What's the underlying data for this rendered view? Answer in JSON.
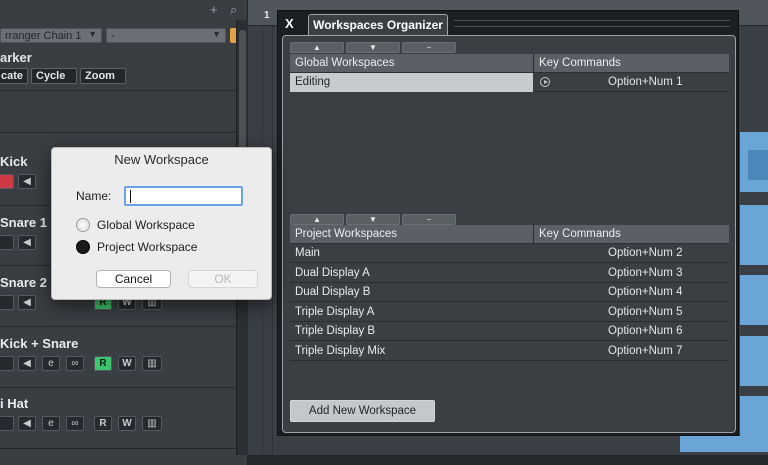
{
  "left_panel": {
    "arranger_dropdown": "rranger Chain 1",
    "arranger_dropdown2": "-",
    "marker_label": "arker",
    "marker_buttons": [
      "cate",
      "Cycle",
      "Zoom"
    ],
    "tracks": [
      {
        "name": "Kick"
      },
      {
        "name": "Snare 1"
      },
      {
        "name": "Snare 2"
      },
      {
        "name": "Kick + Snare"
      },
      {
        "name": "i Hat"
      }
    ],
    "track_button_glyphs": {
      "mute": "◀",
      "edit": "e",
      "link": "∞",
      "read": "R",
      "write": "W",
      "lanes": "▥"
    }
  },
  "ruler": {
    "bar_number": "1"
  },
  "new_workspace_dialog": {
    "title": "New Workspace",
    "name_label": "Name:",
    "name_value": "",
    "options": [
      {
        "label": "Global Workspace",
        "selected": false
      },
      {
        "label": "Project Workspace",
        "selected": true
      }
    ],
    "cancel_label": "Cancel",
    "ok_label": "OK",
    "ok_enabled": false
  },
  "organizer": {
    "close_label": "X",
    "tab_title": "Workspaces Organizer",
    "toolbar_glyphs": [
      "▲",
      "▼",
      "−"
    ],
    "global": {
      "header_name": "Global Workspaces",
      "header_keys": "Key Commands",
      "rows": [
        {
          "name": "Editing",
          "keys": "Option+Num 1",
          "selected": true,
          "has_icon": true
        }
      ]
    },
    "project": {
      "header_name": "Project Workspaces",
      "header_keys": "Key Commands",
      "rows": [
        {
          "name": "Main",
          "keys": "Option+Num 2"
        },
        {
          "name": "Dual Display A",
          "keys": "Option+Num 3"
        },
        {
          "name": "Dual Display B",
          "keys": "Option+Num 4"
        },
        {
          "name": "Triple Display A",
          "keys": "Option+Num 5"
        },
        {
          "name": "Triple Display B",
          "keys": "Option+Num 6"
        },
        {
          "name": "Triple Display Mix",
          "keys": "Option+Num 7"
        }
      ]
    },
    "add_button_label": "Add New Workspace"
  },
  "colors": {
    "record": "#cd3a45",
    "read_active": "#3cc66e",
    "input_focus": "#6aa3e8",
    "event_blue": "#6aa5d6"
  }
}
